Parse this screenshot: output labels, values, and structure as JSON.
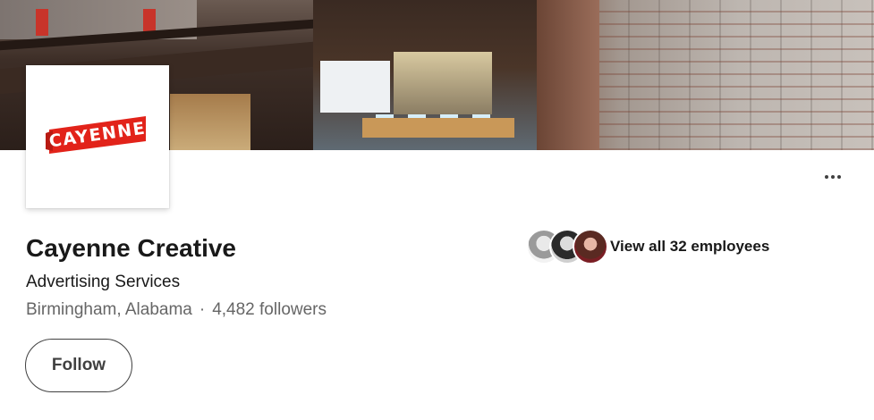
{
  "company": {
    "logo_text": "CAYENNE",
    "name": "Cayenne Creative",
    "industry": "Advertising Services",
    "location": "Birmingham, Alabama",
    "separator": "·",
    "followers": "4,482 followers"
  },
  "employees": {
    "label": "View all 32 employees"
  },
  "actions": {
    "follow_label": "Follow",
    "more_icon": "ellipsis-icon"
  },
  "colors": {
    "brand_red": "#e2231a",
    "text_primary": "#191919",
    "text_secondary": "#666666",
    "button_border": "#404040"
  }
}
